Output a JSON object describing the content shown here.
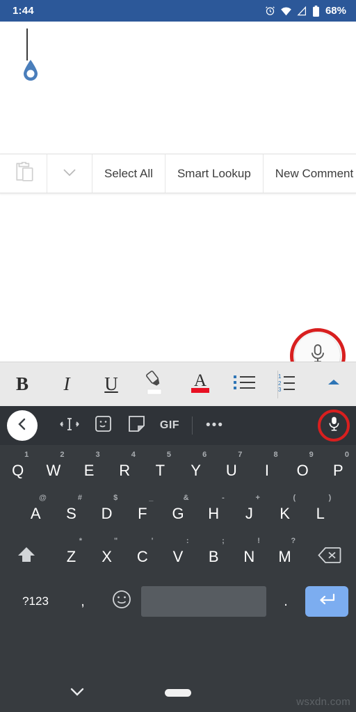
{
  "status_bar": {
    "time": "1:44",
    "battery_percent": "68%",
    "icons": [
      "alarm-icon",
      "wifi-icon",
      "signal-icon",
      "battery-icon"
    ]
  },
  "document": {
    "caret": "text-caret",
    "handle_color": "#4a7ebb",
    "text": ""
  },
  "context_menu": {
    "paste_icon": "paste-icon",
    "overflow_icon": "chevron-down-icon",
    "items": [
      {
        "label": "Select All"
      },
      {
        "label": "Smart Lookup"
      },
      {
        "label": "New Comment"
      }
    ]
  },
  "dictate_fab": {
    "icon": "microphone-icon",
    "highlight_color": "#d81f1f"
  },
  "format_toolbar": {
    "buttons": [
      {
        "label": "B",
        "name": "bold-button"
      },
      {
        "label": "I",
        "name": "italic-button"
      },
      {
        "label": "U",
        "name": "underline-button"
      },
      {
        "label": "",
        "name": "highlighter-button"
      },
      {
        "label": "A",
        "name": "font-color-button"
      },
      {
        "label": "",
        "name": "bulleted-list-button"
      },
      {
        "label": "",
        "name": "numbered-list-button"
      },
      {
        "label": "",
        "name": "expand-toolbar-button"
      }
    ],
    "font_color": "#e81123",
    "list_accent": "#2e75b6"
  },
  "keyboard": {
    "toolbar": {
      "back_icon": "chevron-left-icon",
      "items": [
        {
          "name": "text-edit-icon"
        },
        {
          "name": "sticker-icon"
        },
        {
          "name": "clipboard-icon"
        },
        {
          "name": "gif-button",
          "label": "GIF"
        },
        {
          "name": "more-options-icon",
          "label": "•••"
        }
      ],
      "mic_icon": "microphone-icon",
      "mic_highlight_color": "#d81f1f"
    },
    "row1": [
      {
        "key": "Q",
        "hint": "1"
      },
      {
        "key": "W",
        "hint": "2"
      },
      {
        "key": "E",
        "hint": "3"
      },
      {
        "key": "R",
        "hint": "4"
      },
      {
        "key": "T",
        "hint": "5"
      },
      {
        "key": "Y",
        "hint": "6"
      },
      {
        "key": "U",
        "hint": "7"
      },
      {
        "key": "I",
        "hint": "8"
      },
      {
        "key": "O",
        "hint": "9"
      },
      {
        "key": "P",
        "hint": "0"
      }
    ],
    "row2": [
      {
        "key": "A",
        "hint": "@"
      },
      {
        "key": "S",
        "hint": "#"
      },
      {
        "key": "D",
        "hint": "$"
      },
      {
        "key": "F",
        "hint": "_"
      },
      {
        "key": "G",
        "hint": "&"
      },
      {
        "key": "H",
        "hint": "-"
      },
      {
        "key": "J",
        "hint": "+"
      },
      {
        "key": "K",
        "hint": "("
      },
      {
        "key": "L",
        "hint": ")"
      }
    ],
    "row3": [
      {
        "key": "Z",
        "hint": "*"
      },
      {
        "key": "X",
        "hint": "\""
      },
      {
        "key": "C",
        "hint": "'"
      },
      {
        "key": "V",
        "hint": ":"
      },
      {
        "key": "B",
        "hint": ";"
      },
      {
        "key": "N",
        "hint": "!"
      },
      {
        "key": "M",
        "hint": "?"
      }
    ],
    "shift_icon": "shift-icon",
    "backspace_icon": "backspace-icon",
    "row4": {
      "symbols_label": "?123",
      "comma_label": ",",
      "emoji_icon": "emoji-icon",
      "space_label": "",
      "period_label": ".",
      "enter_icon": "enter-icon",
      "enter_color": "#7cadf0"
    }
  },
  "nav_bar": {
    "dismiss_icon": "chevron-down-icon",
    "home_indicator": "home-pill"
  },
  "watermark": {
    "text": "wsxdn.com"
  }
}
